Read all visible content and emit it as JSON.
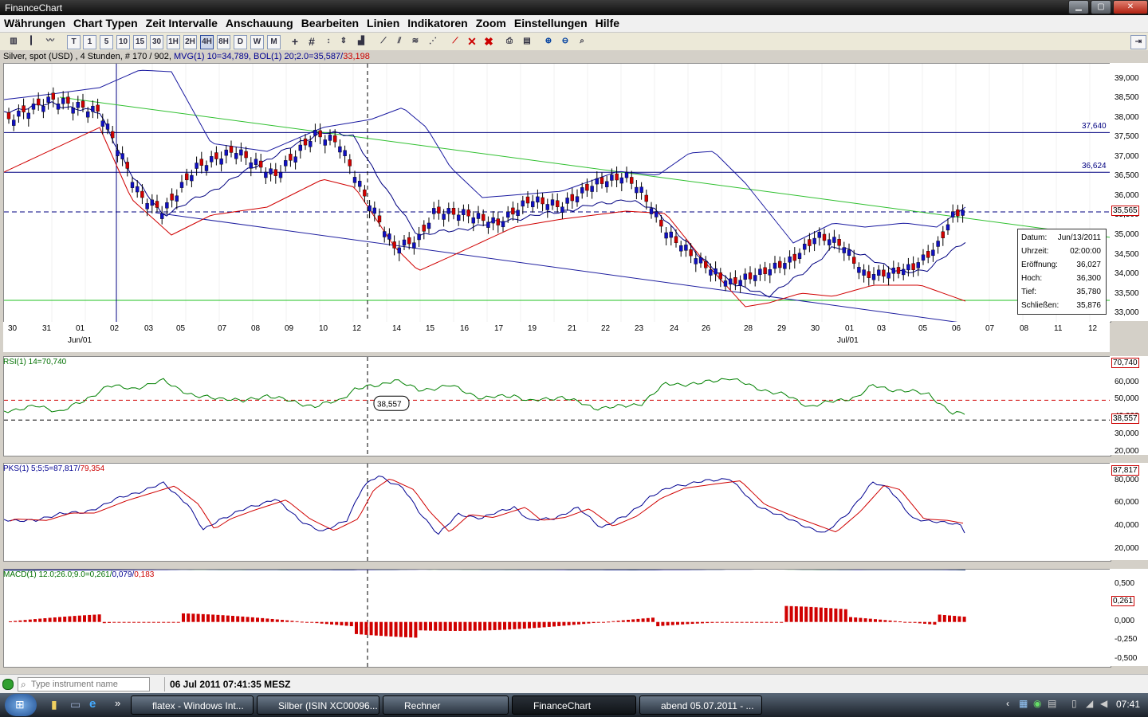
{
  "window": {
    "title": "FinanceChart",
    "buttons": {
      "minimize": "▁",
      "maximize": "▢",
      "close": "✕"
    }
  },
  "menu": [
    "Währungen",
    "Chart Typen",
    "Zeit Intervalle",
    "Anschauung",
    "Bearbeiten",
    "Linien",
    "Indikatoren",
    "Zoom",
    "Einstellungen",
    "Hilfe"
  ],
  "toolbar": {
    "intervals": [
      "T",
      "1",
      "5",
      "10",
      "15",
      "30",
      "1H",
      "2H",
      "4H",
      "8H",
      "D",
      "W",
      "M"
    ],
    "active_interval": "4H"
  },
  "chart": {
    "header_main": "Silver, spot (USD) , 4 Stunden, # 170 / 902, ",
    "header_mvg": "MVG(1) 10=34,789, ",
    "header_bol": "BOL(1) 20;2.0=35,587/",
    "header_bol2": "33,198",
    "y_ticks": [
      "39,000",
      "38,500",
      "38,000",
      "37,500",
      "37,000",
      "36,500",
      "36,000",
      "35,500",
      "35,000",
      "34,500",
      "34,000",
      "33,500",
      "33,000"
    ],
    "y_range": [
      32.8,
      39.4
    ],
    "h_lines": [
      {
        "value": 37.64,
        "label": "37,640",
        "color": "#000080"
      },
      {
        "value": 36.624,
        "label": "36,624",
        "color": "#000080"
      }
    ],
    "last_price": "35,565",
    "support_line": 33.35,
    "x_labels": [
      "30",
      "31",
      "01",
      "02",
      "03",
      "05",
      "07",
      "08",
      "09",
      "10",
      "12",
      "14",
      "15",
      "16",
      "17",
      "19",
      "21",
      "22",
      "23",
      "24",
      "26",
      "28",
      "29",
      "30",
      "01",
      "03",
      "05",
      "06",
      "07",
      "08",
      "11",
      "12"
    ],
    "month_labels": [
      "Jun/01",
      "Jul/01"
    ],
    "info": {
      "labels": [
        "Datum:",
        "Uhrzeit:",
        "Eröffnung:",
        "Hoch:",
        "Tief:",
        "Schließen:"
      ],
      "values": [
        "Jun/13/2011",
        "02:00:00",
        "36,027",
        "36,300",
        "35,780",
        "35,876"
      ]
    },
    "cursor_value": "38,557"
  },
  "rsi": {
    "label": "RSI(1) 14=70,740",
    "ticks": [
      "60,000",
      "50,000",
      "40,000",
      "30,000",
      "20,000"
    ],
    "value_tag": "70,740",
    "cursor_tag": "38,557"
  },
  "pks": {
    "label_a": "PKS(1) 5;5;5=87,817/",
    "label_b": "79,354",
    "ticks": [
      "80,000",
      "60,000",
      "40,000",
      "20,000"
    ],
    "value_tag": "87,817"
  },
  "macd": {
    "label_a": "MACD(1) 12.0;26.0;9.0=0,261/",
    "label_b": "0,079/",
    "label_c": "0,183",
    "ticks": [
      "0,500",
      "0,000",
      "-0,250",
      "-0,500"
    ],
    "value_tag": "0,261"
  },
  "status": {
    "search_placeholder": "Type instrument name",
    "datetime": "06 Jul 2011 07:41:35 MESZ"
  },
  "taskbar": {
    "items": [
      "flatex - Windows Int...",
      "Silber (ISIN XC00096...",
      "Rechner",
      "FinanceChart",
      "abend 05.07.2011 - ..."
    ],
    "active": "FinanceChart",
    "clock": "07:41"
  }
}
